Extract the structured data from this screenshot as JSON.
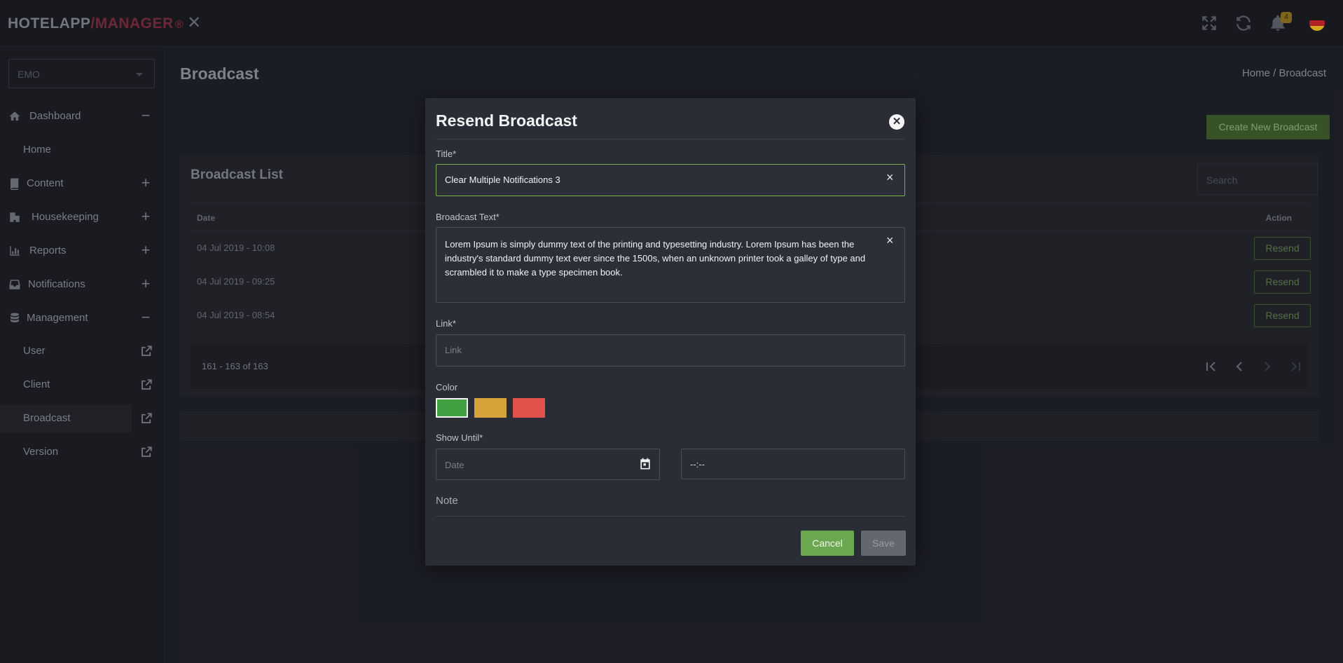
{
  "app": {
    "brand_part1": "HOTELAPP",
    "brand_slash": "/",
    "brand_part2": "MANAGER",
    "brand_mark": "®",
    "notification_count": "4"
  },
  "sidebar": {
    "hotel_select": "EMO",
    "items": [
      {
        "label": "Dashboard",
        "sign": "−",
        "icon": "home-icon"
      },
      {
        "label": "Content",
        "sign": "+",
        "icon": "book-icon"
      },
      {
        "label": "Housekeeping",
        "sign": "+",
        "icon": "building-icon"
      },
      {
        "label": "Reports",
        "sign": "+",
        "icon": "bar-chart-icon"
      },
      {
        "label": "Notifications",
        "sign": "+",
        "icon": "inbox-icon"
      },
      {
        "label": "Management",
        "sign": "−",
        "icon": "database-icon"
      }
    ],
    "dashboard_sub": [
      "Home"
    ],
    "management_sub": [
      "User",
      "Client",
      "Broadcast",
      "Version"
    ]
  },
  "page": {
    "title": "Broadcast",
    "breadcrumb": "Home / Broadcast",
    "create_button": "Create New Broadcast"
  },
  "list": {
    "title": "Broadcast List",
    "search_placeholder": "Search",
    "col_date": "Date",
    "col_action": "Action",
    "rows": [
      {
        "date": "04 Jul 2019 - 10:08",
        "action": "Resend"
      },
      {
        "date": "04 Jul 2019 - 09:25",
        "action": "Resend"
      },
      {
        "date": "04 Jul 2019 - 08:54",
        "action": "Resend"
      }
    ],
    "pagination_info": "161 - 163 of 163"
  },
  "modal": {
    "title": "Resend Broadcast",
    "title_label": "Title*",
    "title_value": "Clear Multiple Notifications 3",
    "text_label": "Broadcast Text*",
    "text_value": "Lorem Ipsum is simply dummy text of the printing and typesetting industry. Lorem Ipsum has been the industry's standard dummy text ever since the 1500s, when an unknown printer took a galley of type and scrambled it to make a type specimen book.",
    "link_label": "Link*",
    "link_placeholder": "Link",
    "color_label": "Color",
    "colors": [
      "#3fa142",
      "#d8a23a",
      "#e2514c"
    ],
    "selected_color": "#3fa142",
    "show_until_label": "Show Until*",
    "date_placeholder": "Date",
    "time_placeholder": "--:--",
    "note_label": "Note",
    "cancel_button": "Cancel",
    "save_button": "Save"
  },
  "colors": {
    "accent_green": "#6aa84f",
    "brand_red": "#7a2a39",
    "flag": [
      "#1a1a1a",
      "#c4232b",
      "#e8b923"
    ]
  }
}
